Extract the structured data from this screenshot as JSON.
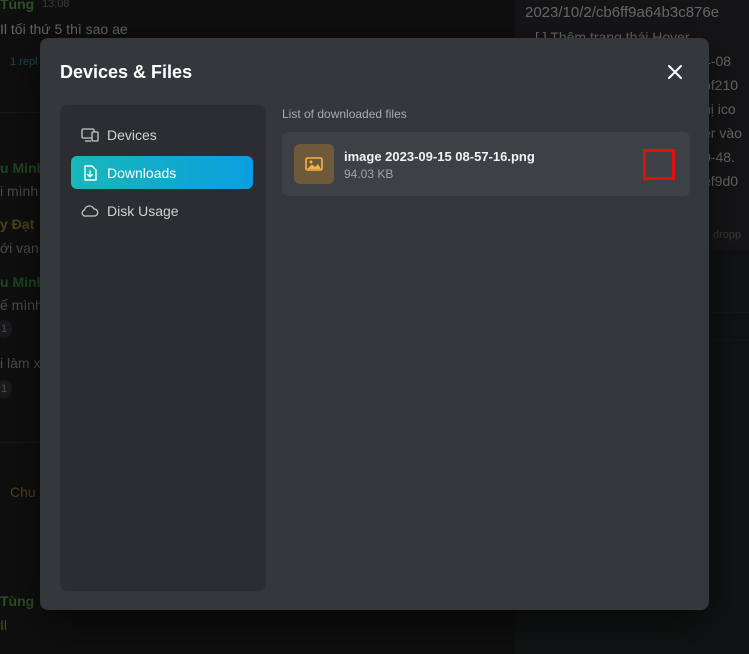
{
  "background": {
    "left_timestamp": "13:08",
    "left_lines": [
      {
        "name": "Tùng",
        "text": "Il tối thứ 5 thì sao ae"
      },
      {
        "name": "u Minh",
        "text": "i mình"
      },
      {
        "name": "y Đạt",
        "text": "ới vạn"
      },
      {
        "name": "u Minh",
        "text": "ế mình"
      },
      {
        "name": "",
        "text": "i làm x"
      },
      {
        "name": "Chu",
        "text": ""
      },
      {
        "name": "Tùng",
        "text": "Il"
      }
    ],
    "replies_label": "1 repl",
    "reaction_counts": [
      "1",
      "1"
    ],
    "right_lines": [
      "2023/10/2/cb6ff9a64b3c876e",
      "[ ] Thêm trạng thái Hover",
      "4-08",
      "bf210",
      "hị ico",
      "er vào",
      "0-48.",
      "ef9d0",
      "dropp"
    ]
  },
  "modal": {
    "title": "Devices & Files",
    "close_icon": "close-icon"
  },
  "sidebar": {
    "items": [
      {
        "label": "Devices",
        "icon": "devices-icon",
        "active": false
      },
      {
        "label": "Downloads",
        "icon": "download-file-icon",
        "active": true
      },
      {
        "label": "Disk Usage",
        "icon": "cloud-icon",
        "active": false
      }
    ]
  },
  "downloads": {
    "list_title": "List of downloaded files",
    "files": [
      {
        "name": "image 2023-09-15 08-57-16.png",
        "size": "94.03 KB",
        "icon": "image-file-icon"
      }
    ]
  },
  "colors": {
    "accent_gradient_start": "#17b8b8",
    "accent_gradient_end": "#0b9ee0",
    "modal_bg": "#34373b",
    "highlight_box": "#e01010"
  }
}
